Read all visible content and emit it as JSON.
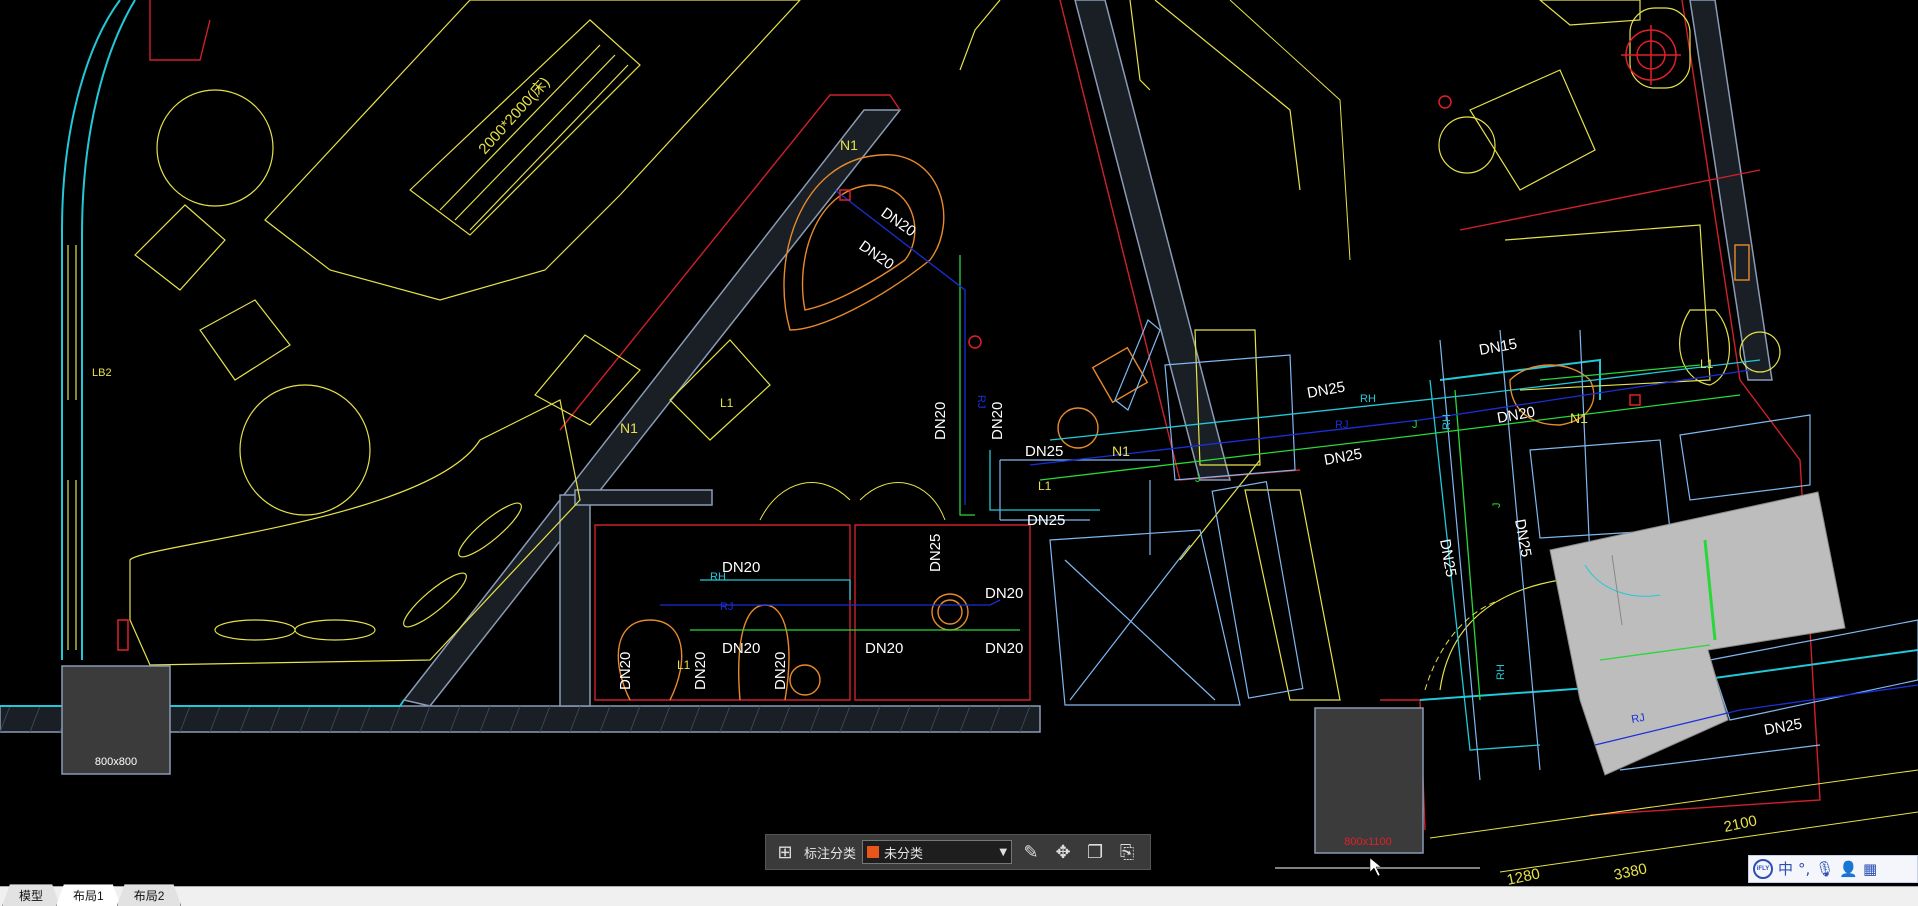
{
  "drawing": {
    "labels": {
      "dn20_a": "DN20",
      "dn20_b": "DN20",
      "dn20_c": "DN20",
      "dn20_d": "DN20",
      "dn20_e": "DN20",
      "dn20_f": "DN20",
      "dn20_g": "DN20",
      "dn20_h": "DN20",
      "dn20_i": "DN20",
      "dn20_j": "DN20",
      "dn20_k": "DN20",
      "dn20_l": "DN20",
      "dn20_m": "DN20",
      "dn25_a": "DN25",
      "dn25_b": "DN25",
      "dn25_c": "DN25",
      "dn25_d": "DN25",
      "dn25_e": "DN25",
      "dn25_f": "DN25",
      "dn25_g": "DN25",
      "dn25_h": "DN25",
      "dn15": "DN15",
      "n1_a": "N1",
      "n1_b": "N1",
      "n1_c": "N1",
      "n1_d": "N1",
      "l1_a": "L1",
      "l1_b": "L1",
      "l1_c": "L1",
      "l1_d": "L1",
      "lb2": "LB2",
      "bed_size": "2000*2000(床)",
      "shaft_1": "800x800",
      "shaft_2": "800x1100",
      "rh_a": "RH",
      "rh_b": "RH",
      "rh_c": "RH",
      "rh_d": "RH",
      "rj_a": "RJ",
      "rj_b": "RJ",
      "rj_c": "RJ",
      "rj_d": "RJ",
      "j_a": "J",
      "j_b": "J",
      "j_c": "J",
      "dim_1": "1280",
      "dim_2": "3380",
      "dim_3": "2100"
    }
  },
  "toolbar": {
    "annotation_label": "标注分类",
    "category_value": "未分类",
    "category_color": "#e8561a",
    "icons": [
      "grid-icon",
      "edit-icon",
      "move-icon",
      "copy-icon",
      "paste-icon"
    ]
  },
  "tabs": [
    "模型",
    "布局1",
    "布局2"
  ],
  "active_tab": "布局1",
  "ime": {
    "mode": "中",
    "punct": "°,",
    "badge": "iFLY"
  }
}
